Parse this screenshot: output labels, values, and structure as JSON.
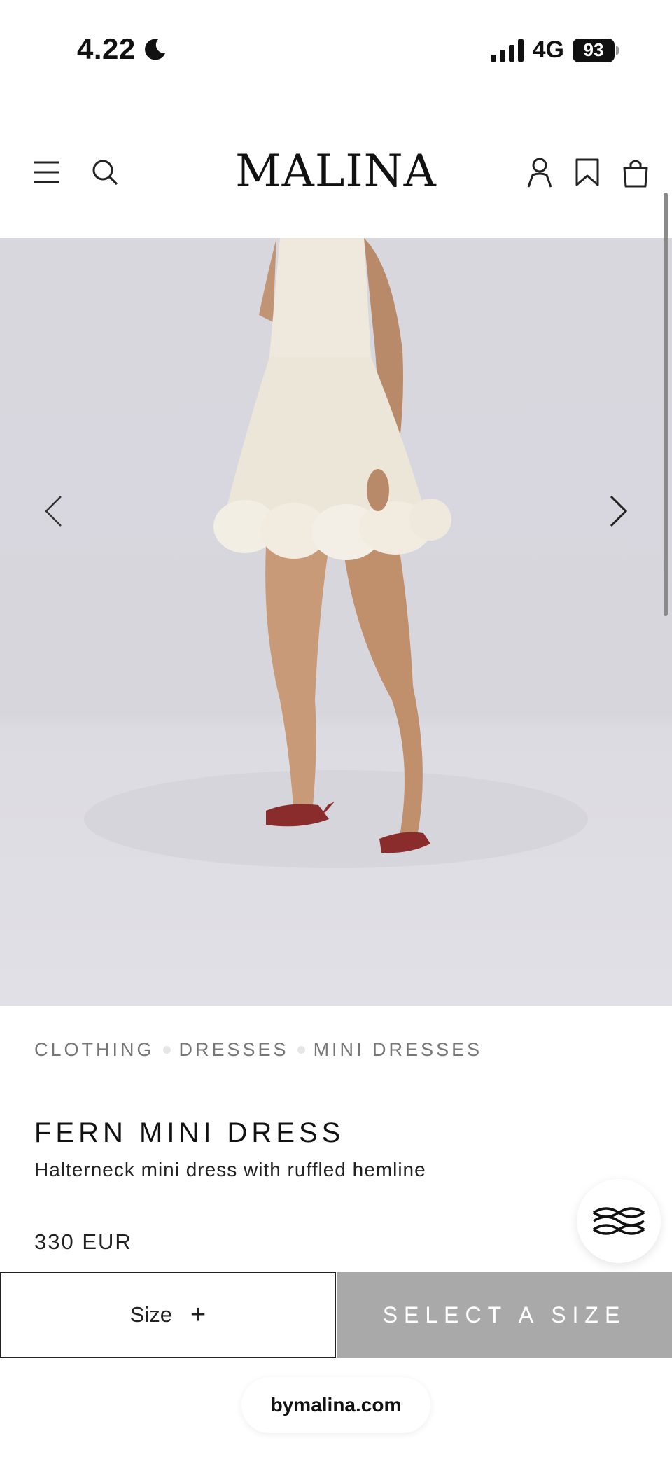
{
  "status_bar": {
    "time": "4.22",
    "network": "4G",
    "battery": "93"
  },
  "header": {
    "logo": "MALINA"
  },
  "breadcrumb": [
    "CLOTHING",
    "DRESSES",
    "MINI DRESSES"
  ],
  "product": {
    "name": "FERN MINI DRESS",
    "description": "Halterneck mini dress with ruffled hemline",
    "price": "330 EUR"
  },
  "actions": {
    "size_label": "Size",
    "size_plus": "+",
    "select_label": "SELECT A SIZE"
  },
  "browser": {
    "url": "bymalina.com"
  },
  "icons": {
    "menu": "hamburger-menu-icon",
    "search": "search-icon",
    "account": "account-icon",
    "wishlist": "bookmark-icon",
    "bag": "shopping-bag-icon",
    "prev": "chevron-left-icon",
    "next": "chevron-right-icon",
    "chat": "chat-logo-icon"
  },
  "colors": {
    "select_button_bg": "#a9a9a9",
    "hero_bg": "#d8d7de"
  }
}
